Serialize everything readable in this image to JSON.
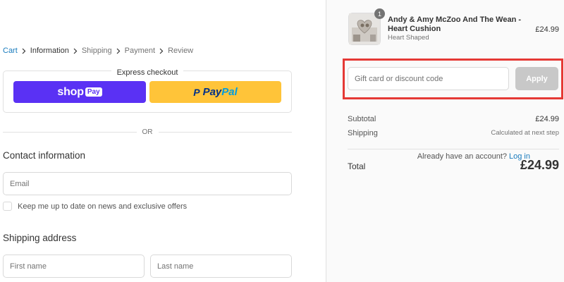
{
  "breadcrumb": {
    "items": [
      {
        "label": "Cart",
        "state": "link"
      },
      {
        "label": "Information",
        "state": "current"
      },
      {
        "label": "Shipping",
        "state": "upcoming"
      },
      {
        "label": "Payment",
        "state": "upcoming"
      },
      {
        "label": "Review",
        "state": "upcoming"
      }
    ]
  },
  "express": {
    "title": "Express checkout",
    "shop_pay": {
      "text": "shop",
      "badge": "Pay"
    },
    "paypal": {
      "mark": "P",
      "text1": "Pay",
      "text2": "Pal"
    }
  },
  "divider": {
    "or": "OR"
  },
  "contact": {
    "title": "Contact information",
    "account_prompt": "Already have an account?",
    "login_label": "Log in",
    "email_placeholder": "Email",
    "newsletter_label": "Keep me up to date on news and exclusive offers"
  },
  "shipping": {
    "title": "Shipping address",
    "first_name_placeholder": "First name",
    "last_name_placeholder": "Last name"
  },
  "order": {
    "product": {
      "title": "Andy & Amy McZoo And The Wean - Heart Cushion",
      "variant": "Heart Shaped",
      "price": "£24.99",
      "quantity": "1"
    },
    "discount": {
      "placeholder": "Gift card or discount code",
      "apply_label": "Apply"
    },
    "summary": {
      "subtotal_label": "Subtotal",
      "subtotal_value": "£24.99",
      "shipping_label": "Shipping",
      "shipping_value": "Calculated at next step",
      "total_label": "Total",
      "total_value": "£24.99"
    }
  },
  "colors": {
    "link": "#197bbd",
    "shop_pay": "#5a31f4",
    "paypal": "#ffc439",
    "highlight": "#e53935",
    "apply_disabled": "#c8c8c8"
  }
}
